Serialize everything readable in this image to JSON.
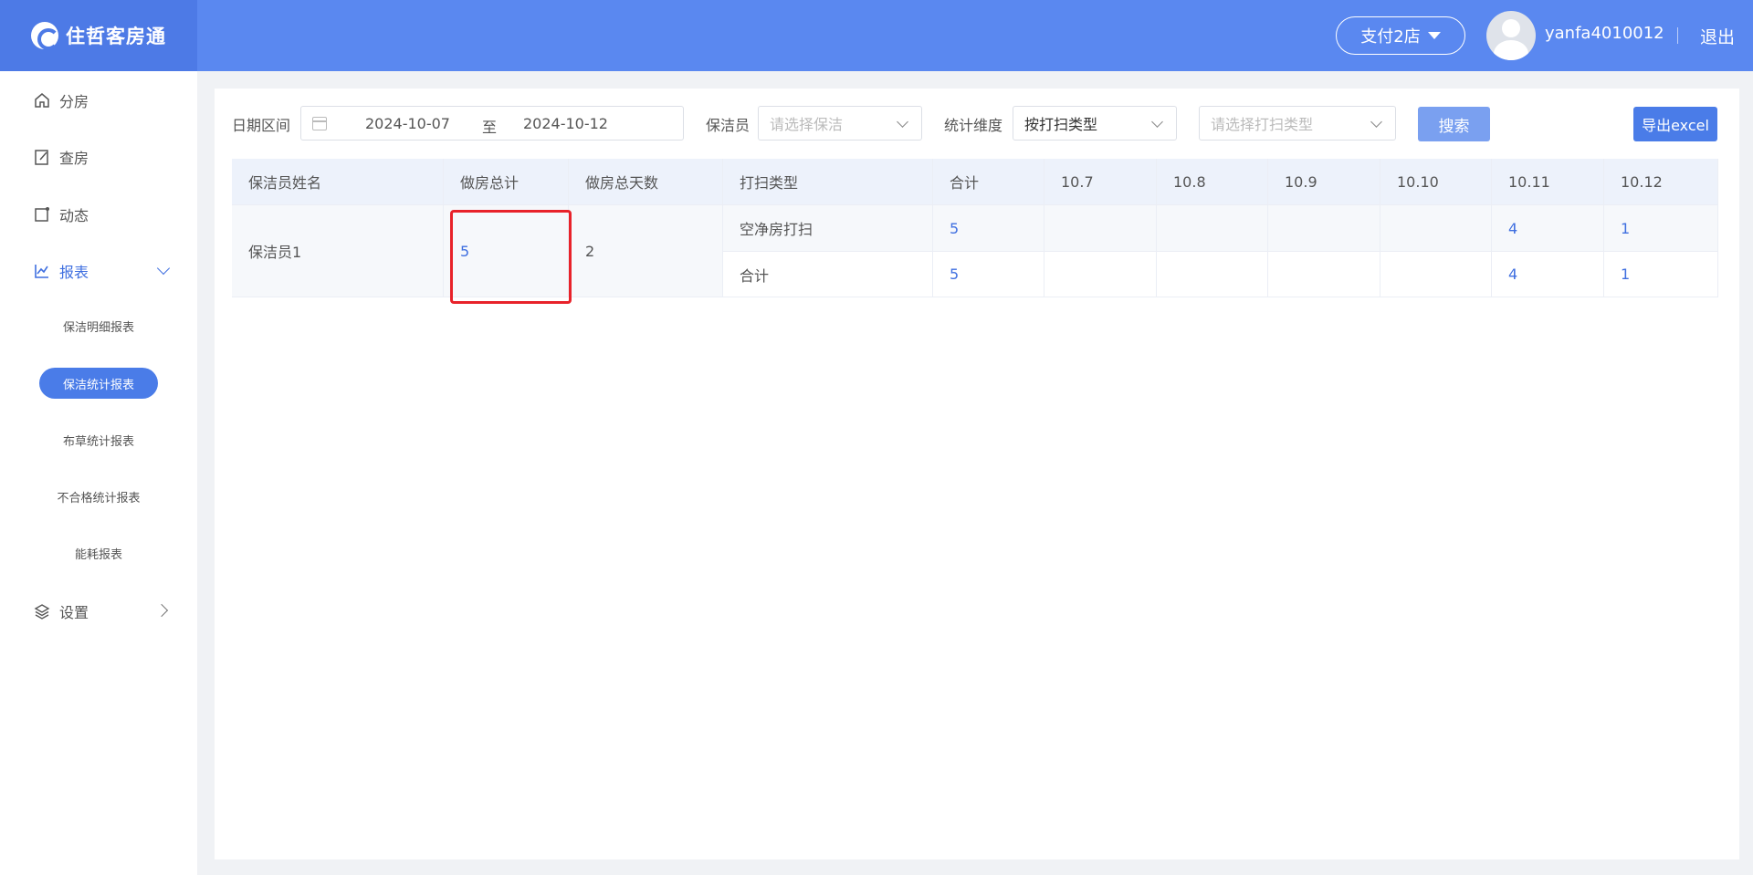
{
  "header": {
    "app_name": "住哲客房通",
    "store_selector": "支付2店",
    "username": "yanfa4010012",
    "logout": "退出"
  },
  "sidebar": {
    "items": [
      {
        "label": "分房",
        "icon": "home-icon"
      },
      {
        "label": "查房",
        "icon": "edit-icon"
      },
      {
        "label": "动态",
        "icon": "notification-icon"
      },
      {
        "label": "报表",
        "icon": "chart-icon",
        "expanded": true
      },
      {
        "label": "设置",
        "icon": "layers-icon"
      }
    ],
    "report_sub_items": [
      {
        "label": "保洁明细报表",
        "active": false
      },
      {
        "label": "保洁统计报表",
        "active": true
      },
      {
        "label": "布草统计报表",
        "active": false
      },
      {
        "label": "不合格统计报表",
        "active": false
      },
      {
        "label": "能耗报表",
        "active": false
      }
    ]
  },
  "filters": {
    "date_label": "日期区间",
    "date_start": "2024-10-07",
    "date_sep": "至",
    "date_end": "2024-10-12",
    "cleaner_label": "保洁员",
    "cleaner_placeholder": "请选择保洁",
    "dimension_label": "统计维度",
    "dimension_value": "按打扫类型",
    "type_placeholder": "请选择打扫类型",
    "search_button": "搜索",
    "export_button": "导出excel"
  },
  "table": {
    "headers": [
      "保洁员姓名",
      "做房总计",
      "做房总天数",
      "打扫类型",
      "合计",
      "10.7",
      "10.8",
      "10.9",
      "10.10",
      "10.11",
      "10.12"
    ],
    "cleaner_name": "保洁员1",
    "total_rooms": "5",
    "total_days": "2",
    "rows": [
      {
        "type": "空净房打扫",
        "total": "5",
        "d10_7": "",
        "d10_8": "",
        "d10_9": "",
        "d10_10": "",
        "d10_11": "4",
        "d10_12": "1"
      },
      {
        "type": "合计",
        "total": "5",
        "d10_7": "",
        "d10_8": "",
        "d10_9": "",
        "d10_10": "",
        "d10_11": "4",
        "d10_12": "1"
      }
    ]
  },
  "colors": {
    "header_bg": "#5a88f0",
    "accent": "#4a7ce8",
    "link": "#3f6fe0",
    "highlight": "#e8222a"
  }
}
